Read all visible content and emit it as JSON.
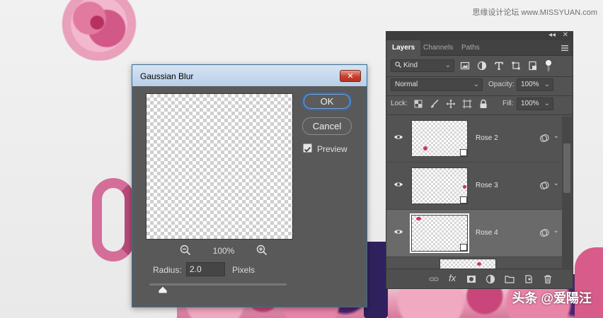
{
  "watermarks": {
    "top": "思缘设计论坛 www.MISSYUAN.com",
    "bottom": "头条 @爱陽汪"
  },
  "dialog": {
    "title": "Gaussian Blur",
    "close_label": "✕",
    "ok_label": "OK",
    "cancel_label": "Cancel",
    "preview_label": "Preview",
    "preview_checked": true,
    "zoom_level": "100%",
    "radius_label": "Radius:",
    "radius_value": "2.0",
    "radius_unit": "Pixels",
    "radius_slider_fraction": 0.1
  },
  "layers_panel": {
    "topbar": {
      "collapse": "◂◂",
      "close": "✕"
    },
    "tabs": [
      {
        "label": "Layers",
        "active": true
      },
      {
        "label": "Channels",
        "active": false
      },
      {
        "label": "Paths",
        "active": false
      }
    ],
    "filter": {
      "label": "Kind",
      "caret": "⌄"
    },
    "blend_mode": {
      "value": "Normal",
      "caret": "⌄"
    },
    "opacity": {
      "label": "Opacity:",
      "value": "100%",
      "caret": "⌄"
    },
    "lock": {
      "label": "Lock:"
    },
    "fill": {
      "label": "Fill:",
      "value": "100%",
      "caret": "⌄"
    },
    "layers": [
      {
        "name": "Rose 2",
        "selected": false
      },
      {
        "name": "Rose 3",
        "selected": false
      },
      {
        "name": "Rose 4",
        "selected": true
      }
    ],
    "footer": {
      "fx_label": "fx"
    }
  },
  "colors": {
    "panel_bg": "#535353",
    "dialog_bg": "#595959",
    "titlebar": "#c8dbef",
    "ok_border": "#2e6fbd",
    "close_button": "#c6402c"
  }
}
